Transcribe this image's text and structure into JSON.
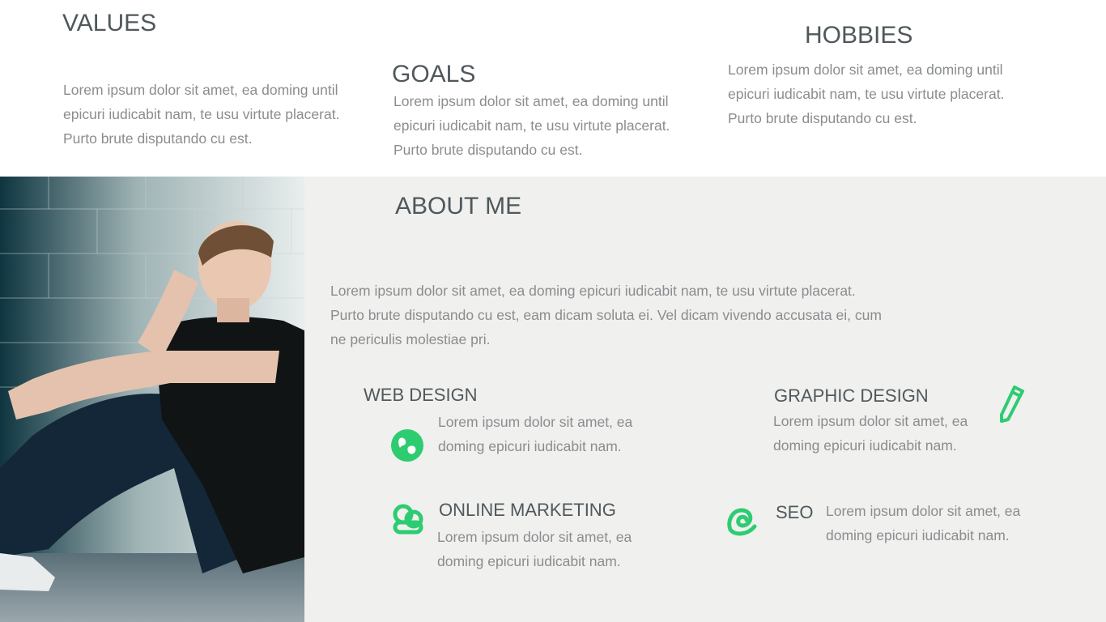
{
  "values": {
    "title": "VALUES",
    "text": "Lorem ipsum dolor sit amet, ea doming until epicuri iudicabit nam, te usu virtute placerat. Purto brute disputando cu est."
  },
  "goals": {
    "title": "GOALS",
    "text": "Lorem ipsum dolor sit amet, ea doming until epicuri iudicabit nam, te usu virtute placerat. Purto brute disputando cu est."
  },
  "hobbies": {
    "title": "HOBBIES",
    "text": "Lorem ipsum dolor sit amet, ea doming until epicuri iudicabit nam, te usu virtute placerat. Purto brute disputando cu est."
  },
  "about": {
    "title": "ABOUT ME",
    "text": "Lorem ipsum dolor sit amet, ea doming epicuri iudicabit nam, te usu virtute placerat. Purto brute disputando cu est, eam dicam soluta ei. Vel dicam vivendo accusata ei, cum ne periculis molestiae pri."
  },
  "services": {
    "web_design": {
      "title": "WEB DESIGN",
      "text": "Lorem ipsum dolor sit amet, ea doming epicuri iudicabit nam.",
      "icon": "globe-icon"
    },
    "graphic_design": {
      "title": "GRAPHIC DESIGN",
      "text": "Lorem ipsum dolor sit amet, ea doming epicuri iudicabit nam.",
      "icon": "pencil-icon"
    },
    "online_marketing": {
      "title": "ONLINE MARKETING",
      "text": "Lorem ipsum dolor sit amet, ea doming epicuri iudicabit nam.",
      "icon": "people-icon"
    },
    "seo": {
      "title": "SEO",
      "text": "Lorem ipsum dolor sit amet, ea doming epicuri iudicabit nam.",
      "icon": "spiral-icon"
    }
  },
  "colors": {
    "accent": "#2ecc71",
    "heading": "#4f585b",
    "body_text": "#8a8d8e",
    "panel_bg": "#f0f0ef"
  }
}
